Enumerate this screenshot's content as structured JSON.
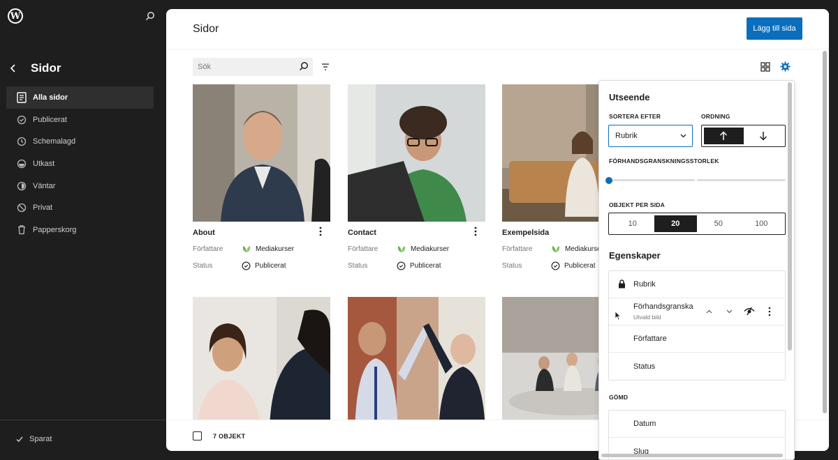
{
  "sidebar": {
    "title": "Sidor",
    "items": [
      {
        "label": "Alla sidor",
        "icon": "pages-icon",
        "active": true
      },
      {
        "label": "Publicerat",
        "icon": "published-icon"
      },
      {
        "label": "Schemalagd",
        "icon": "scheduled-icon"
      },
      {
        "label": "Utkast",
        "icon": "draft-icon"
      },
      {
        "label": "Väntar",
        "icon": "pending-icon"
      },
      {
        "label": "Privat",
        "icon": "private-icon"
      },
      {
        "label": "Papperskorg",
        "icon": "trash-icon"
      }
    ],
    "saved_label": "Sparat"
  },
  "main": {
    "title": "Sidor",
    "add_button": "Lägg till sida",
    "search_placeholder": "Sök",
    "cards": [
      {
        "title": "About",
        "author_label": "Författare",
        "author": "Mediakurser",
        "status_label": "Status",
        "status": "Publicerat"
      },
      {
        "title": "Contact",
        "author_label": "Författare",
        "author": "Mediakurser",
        "status_label": "Status",
        "status": "Publicerat"
      },
      {
        "title": "Exempelsida",
        "author_label": "Författare",
        "author": "Mediakurser",
        "status_label": "Status",
        "status": "Publicerat"
      }
    ],
    "footer_count": "7 OBJEKT"
  },
  "panel": {
    "appearance_title": "Utseende",
    "sort_label": "SORTERA EFTER",
    "sort_value": "Rubrik",
    "order_label": "ORDNING",
    "preview_size_label": "FÖRHANDSGRANSKNINGSSTORLEK",
    "preview_size_level": 0,
    "per_page_label": "OBJEKT PER SIDA",
    "per_page_options": [
      "10",
      "20",
      "50",
      "100"
    ],
    "per_page_selected": "20",
    "properties_title": "Egenskaper",
    "properties": [
      {
        "label": "Rubrik",
        "locked": true
      },
      {
        "label": "Förhandsgranska",
        "sub": "Utvald bild"
      },
      {
        "label": "Författare"
      },
      {
        "label": "Status"
      }
    ],
    "hidden_label": "GÖMD",
    "hidden_properties": [
      {
        "label": "Datum"
      },
      {
        "label": "Slug"
      }
    ]
  },
  "colors": {
    "accent": "#0a6ebd",
    "dark": "#1e1e1e",
    "author_avatar": "#6ab04c"
  }
}
